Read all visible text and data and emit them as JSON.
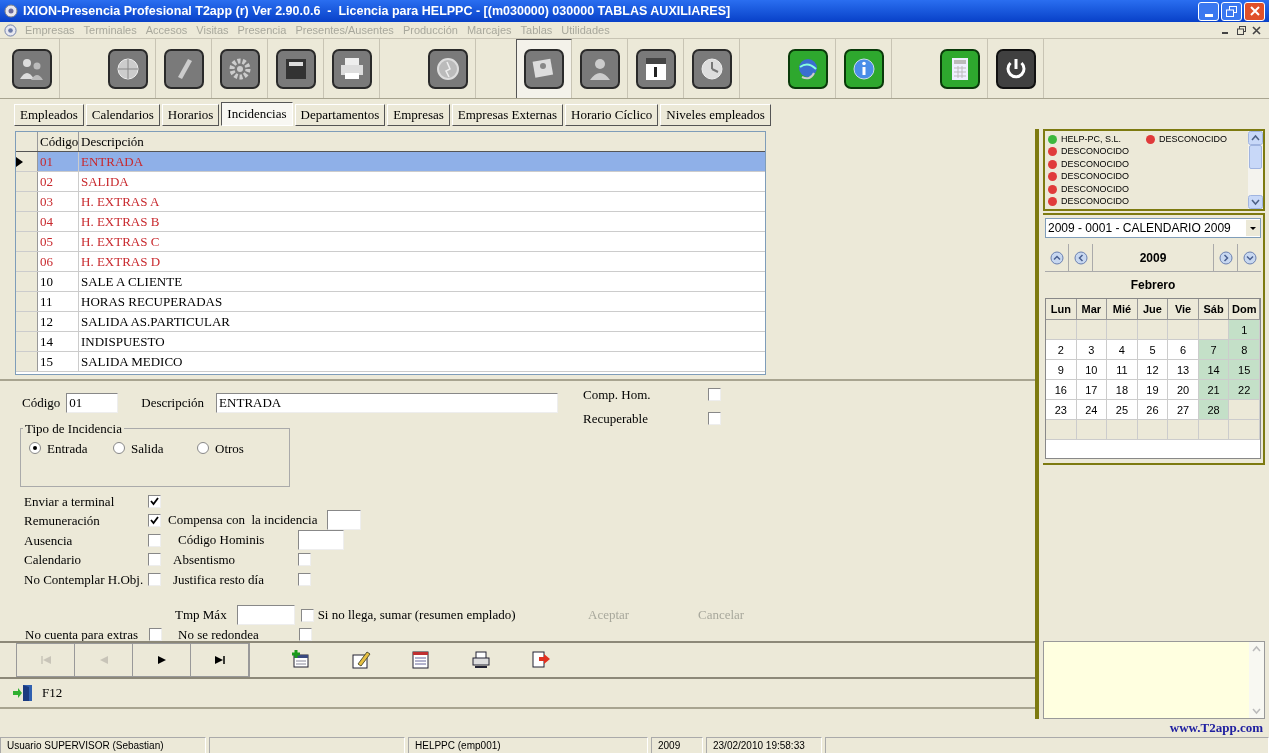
{
  "window": {
    "title": "IXION-Presencia Profesional T2app (r) Ver 2.90.0.6  -  Licencia para HELPPC - [(m030000) 030000 TABLAS AUXILIARES]"
  },
  "menu": [
    {
      "label": "Empresas",
      "disabled": true
    },
    {
      "label": "Terminales",
      "disabled": true
    },
    {
      "label": "Accesos",
      "disabled": true
    },
    {
      "label": "Visitas",
      "disabled": true
    },
    {
      "label": "Presencia",
      "disabled": true
    },
    {
      "label": "Presentes/Ausentes",
      "disabled": true
    },
    {
      "label": "Producción",
      "disabled": true
    },
    {
      "label": "Marcajes",
      "disabled": true
    },
    {
      "label": "Tablas",
      "disabled": true
    },
    {
      "label": "Utilidades",
      "disabled": true
    }
  ],
  "toolbar": {
    "groups": [
      [
        {
          "pressed": false
        }
      ],
      [
        {
          "pressed": false
        },
        {
          "pressed": false
        },
        {
          "pressed": false
        },
        {
          "pressed": false
        },
        {
          "pressed": false
        }
      ],
      [
        {
          "pressed": false
        }
      ],
      [
        {
          "pressed": true
        },
        {
          "pressed": false
        },
        {
          "pressed": false
        },
        {
          "pressed": false
        }
      ],
      [
        {
          "pressed": false
        },
        {
          "pressed": false
        }
      ],
      [
        {
          "pressed": false
        },
        {
          "pressed": false
        }
      ]
    ]
  },
  "tabs": [
    {
      "label": "Empleados",
      "selected": false
    },
    {
      "label": "Calendarios",
      "selected": false
    },
    {
      "label": "Horarios",
      "selected": false
    },
    {
      "label": "Incidencias",
      "selected": true
    },
    {
      "label": "Departamentos",
      "selected": false
    },
    {
      "label": "Empresas",
      "selected": false
    },
    {
      "label": "Empresas Externas",
      "selected": false
    },
    {
      "label": "Horario Cíclico",
      "selected": false
    },
    {
      "label": "Niveles empleados",
      "selected": false
    }
  ],
  "table": {
    "columns": [
      "Código",
      "Descripción"
    ],
    "rows": [
      {
        "code": "01",
        "description": "ENTRADA",
        "color": "#c8282d",
        "selected": true
      },
      {
        "code": "02",
        "description": "SALIDA",
        "color": "#c8282d",
        "selected": false
      },
      {
        "code": "03",
        "description": "H. EXTRAS A",
        "color": "#c8282d",
        "selected": false
      },
      {
        "code": "04",
        "description": "H. EXTRAS B",
        "color": "#c8282d",
        "selected": false
      },
      {
        "code": "05",
        "description": "H. EXTRAS C",
        "color": "#c8282d",
        "selected": false
      },
      {
        "code": "06",
        "description": "H. EXTRAS D",
        "color": "#c8282d",
        "selected": false
      },
      {
        "code": "10",
        "description": "SALE A CLIENTE",
        "color": "#000000",
        "selected": false
      },
      {
        "code": "11",
        "description": "HORAS RECUPERADAS",
        "color": "#000000",
        "selected": false
      },
      {
        "code": "12",
        "description": "SALIDA AS.PARTICULAR",
        "color": "#000000",
        "selected": false
      },
      {
        "code": "14",
        "description": "INDISPUESTO",
        "color": "#000000",
        "selected": false
      },
      {
        "code": "15",
        "description": "SALIDA MEDICO",
        "color": "#000000",
        "selected": false
      }
    ]
  },
  "form": {
    "codigo": {
      "label": "Código",
      "value": "01"
    },
    "descripcion": {
      "label": "Descripción",
      "value": "ENTRADA"
    },
    "side_checks": [
      {
        "label": "Comp. Hom.",
        "checked": false
      },
      {
        "label": "Recuperable",
        "checked": false
      }
    ],
    "tipo": {
      "title": "Tipo de Incidencia",
      "options": [
        {
          "label": "Entrada",
          "selected": true
        },
        {
          "label": "Salida",
          "selected": false
        },
        {
          "label": "Otros",
          "selected": false
        }
      ]
    },
    "flags": [
      {
        "label": "Enviar a terminal",
        "checked": true
      },
      {
        "label": "Remuneración",
        "checked": true
      },
      {
        "label": "Ausencia",
        "checked": false
      },
      {
        "label": "Calendario",
        "checked": false
      },
      {
        "label": "No Contemplar H.Obj.",
        "checked": false
      }
    ],
    "extra": [
      {
        "kind": "input",
        "label": "Compensa con  la incidencia"
      },
      {
        "kind": "input",
        "label": "Código Hominis"
      },
      {
        "kind": "check",
        "label": "Absentismo",
        "checked": false
      },
      {
        "kind": "check",
        "label": "Justifica resto día",
        "checked": false
      }
    ],
    "tmp_max": {
      "label": "Tmp Máx"
    },
    "sumar": {
      "label": "Si no llega, sumar (resumen emplado)",
      "checked": false
    },
    "no_cuenta": {
      "label": "No cuenta para extras",
      "checked": false
    },
    "no_redondea": {
      "label": "No se redondea",
      "checked": false
    },
    "buttons": [
      {
        "label": "Aceptar",
        "disabled": true
      },
      {
        "label": "Cancelar",
        "disabled": true
      }
    ]
  },
  "navigator": [
    {
      "kind": "first",
      "disabled": true
    },
    {
      "kind": "prev",
      "disabled": true
    },
    {
      "kind": "next",
      "disabled": false
    },
    {
      "kind": "last",
      "disabled": false
    }
  ],
  "actions": [
    {
      "kind": "add"
    },
    {
      "kind": "edit"
    },
    {
      "kind": "list"
    },
    {
      "kind": "print"
    },
    {
      "kind": "export"
    }
  ],
  "shortcut": {
    "label": "F12"
  },
  "status_list": {
    "rows": [
      [
        {
          "label": "HELP-PC, S.L.",
          "color": "#3cb83c"
        },
        {
          "label": "DESCONOCIDO",
          "color": "#e03a3a"
        }
      ],
      [
        {
          "label": "DESCONOCIDO",
          "color": "#e03a3a"
        }
      ],
      [
        {
          "label": "DESCONOCIDO",
          "color": "#e03a3a"
        }
      ],
      [
        {
          "label": "DESCONOCIDO",
          "color": "#e03a3a"
        }
      ],
      [
        {
          "label": "DESCONOCIDO",
          "color": "#e03a3a"
        }
      ],
      [
        {
          "label": "DESCONOCIDO",
          "color": "#e03a3a"
        }
      ]
    ]
  },
  "calendar": {
    "selector": "2009 - 0001 - CALENDARIO 2009",
    "year": "2009",
    "month": "Febrero",
    "weekdays": [
      "Lun",
      "Mar",
      "Mié",
      "Jue",
      "Vie",
      "Sáb",
      "Dom"
    ],
    "weeks": [
      [
        {
          "free": false
        },
        {
          "free": false
        },
        {
          "free": false
        },
        {
          "free": false
        },
        {
          "free": false
        },
        {
          "free": false
        },
        {
          "day": "1",
          "free": true
        }
      ],
      [
        {
          "day": "2",
          "free": false
        },
        {
          "day": "3",
          "free": false
        },
        {
          "day": "4",
          "free": false
        },
        {
          "day": "5",
          "free": false
        },
        {
          "day": "6",
          "free": false
        },
        {
          "day": "7",
          "free": true
        },
        {
          "day": "8",
          "free": true
        }
      ],
      [
        {
          "day": "9",
          "free": false
        },
        {
          "day": "10",
          "free": false
        },
        {
          "day": "11",
          "free": false
        },
        {
          "day": "12",
          "free": false
        },
        {
          "day": "13",
          "free": false
        },
        {
          "day": "14",
          "free": true
        },
        {
          "day": "15",
          "free": true
        }
      ],
      [
        {
          "day": "16",
          "free": false
        },
        {
          "day": "17",
          "free": false
        },
        {
          "day": "18",
          "free": false
        },
        {
          "day": "19",
          "free": false
        },
        {
          "day": "20",
          "free": false
        },
        {
          "day": "21",
          "free": true
        },
        {
          "day": "22",
          "free": true
        }
      ],
      [
        {
          "day": "23",
          "free": false
        },
        {
          "day": "24",
          "free": false
        },
        {
          "day": "25",
          "free": false
        },
        {
          "day": "26",
          "free": false
        },
        {
          "day": "27",
          "free": false
        },
        {
          "day": "28",
          "free": true
        },
        {
          "free": false
        }
      ]
    ]
  },
  "website": "www.T2app.com",
  "status_bar": [
    {
      "kind": "text",
      "text": "Usuario SUPERVISOR (Sebastian)"
    },
    {
      "kind": "blank"
    },
    {
      "kind": "text",
      "text": "HELPPC  (emp001)"
    },
    {
      "kind": "text",
      "text": "2009"
    },
    {
      "kind": "text",
      "text": "23/02/2010 19:58:33"
    },
    {
      "kind": "blank"
    }
  ]
}
